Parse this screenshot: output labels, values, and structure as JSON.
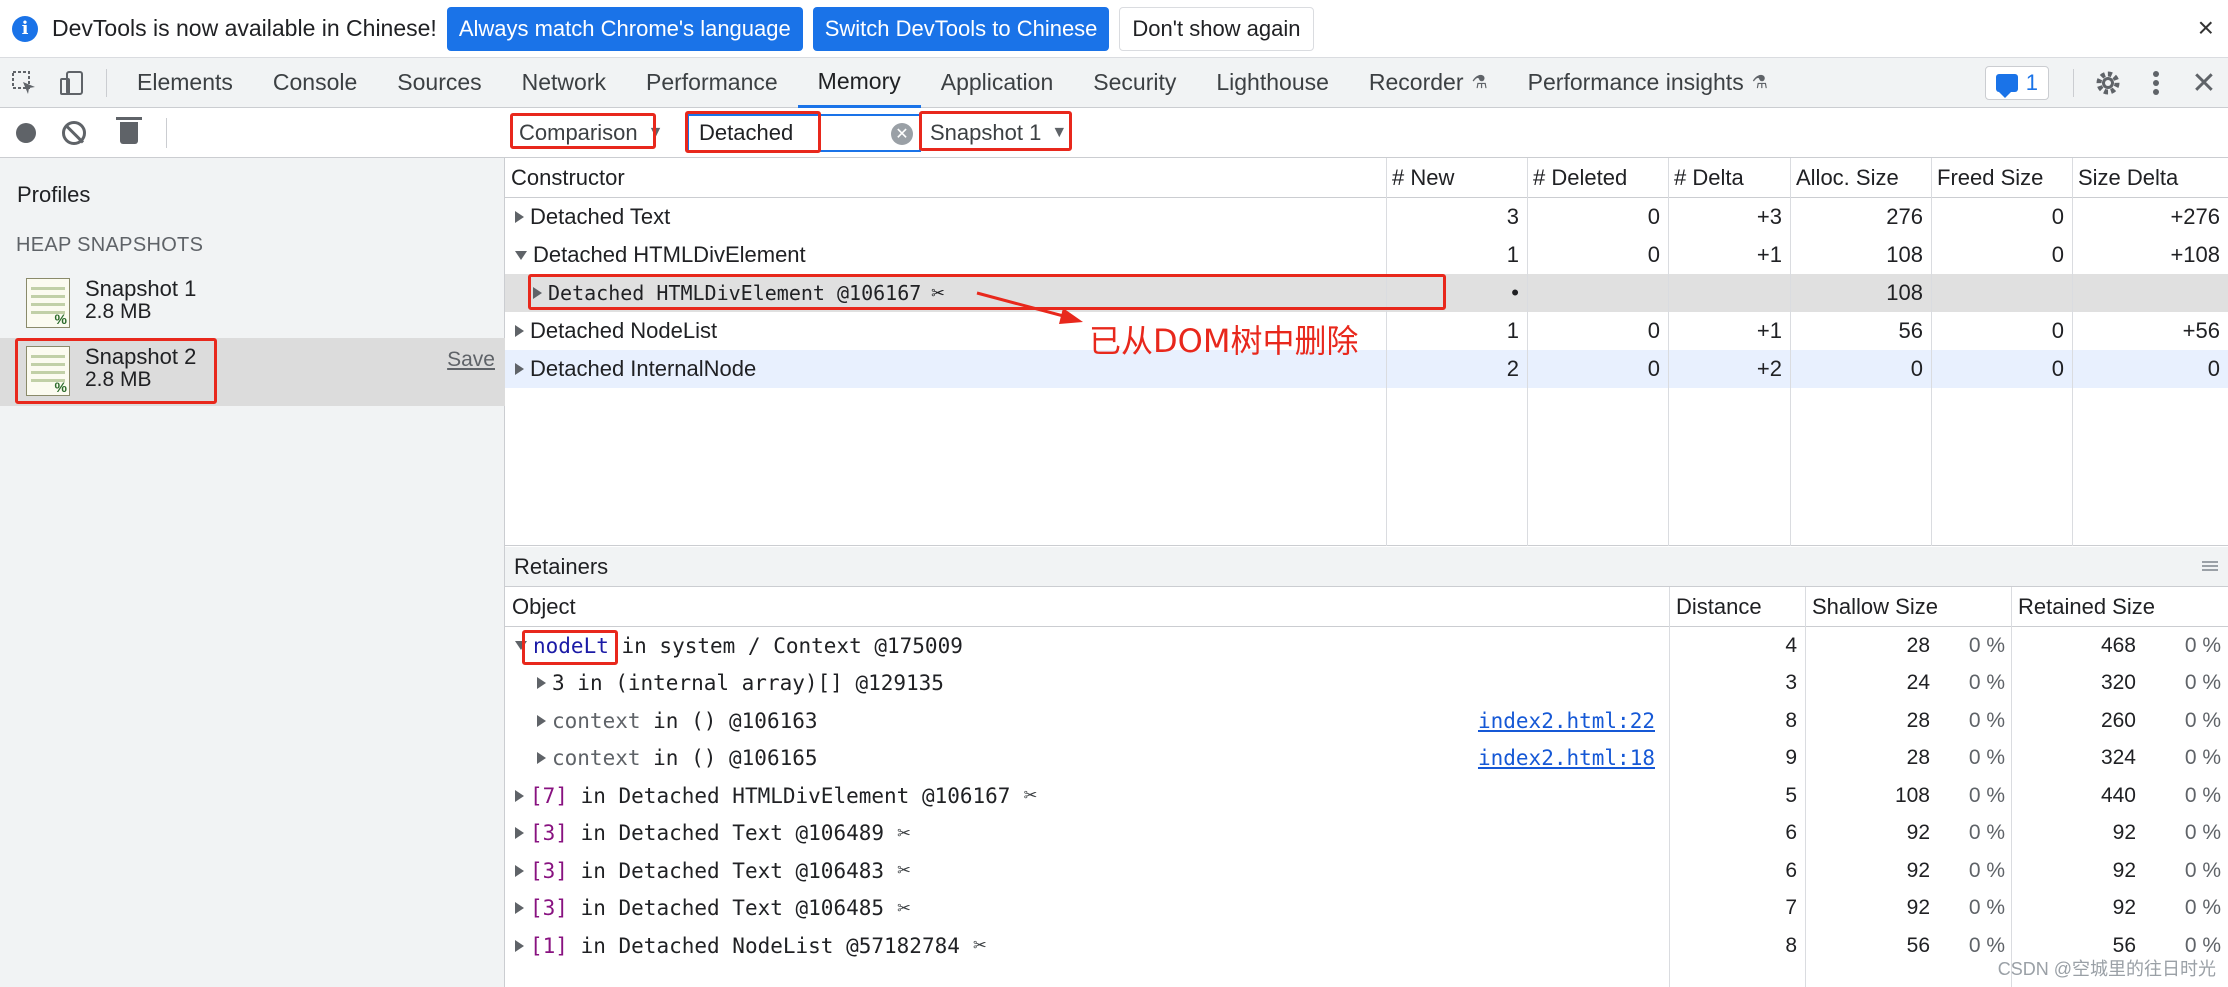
{
  "infobar": {
    "message": "DevTools is now available in Chinese!",
    "btn_match": "Always match Chrome's language",
    "btn_switch": "Switch DevTools to Chinese",
    "btn_dismiss": "Don't show again",
    "close": "×"
  },
  "tabs": [
    {
      "label": "Elements"
    },
    {
      "label": "Console"
    },
    {
      "label": "Sources"
    },
    {
      "label": "Network"
    },
    {
      "label": "Performance"
    },
    {
      "label": "Memory"
    },
    {
      "label": "Application"
    },
    {
      "label": "Security"
    },
    {
      "label": "Lighthouse"
    },
    {
      "label": "Recorder"
    },
    {
      "label": "Performance insights"
    }
  ],
  "tabbar": {
    "active_tab": "Memory",
    "issues_count": "1"
  },
  "toolbar": {
    "view": "Comparison",
    "filter": "Detached",
    "base_snapshot": "Snapshot 1"
  },
  "sidebar": {
    "title": "Profiles",
    "heading": "HEAP SNAPSHOTS",
    "snapshots": [
      {
        "name": "Snapshot 1",
        "size": "2.8 MB"
      },
      {
        "name": "Snapshot 2",
        "size": "2.8 MB",
        "action": "Save"
      }
    ]
  },
  "grid": {
    "headers": [
      "Constructor",
      "# New",
      "# Deleted",
      "# Delta",
      "Alloc. Size",
      "Freed Size",
      "Size Delta"
    ],
    "rows": [
      {
        "name": "Detached Text",
        "new": "3",
        "deleted": "0",
        "delta": "+3",
        "alloc": "276",
        "freed": "0",
        "size_delta": "+276"
      },
      {
        "name": "Detached HTMLDivElement",
        "new": "1",
        "deleted": "0",
        "delta": "+1",
        "alloc": "108",
        "freed": "0",
        "size_delta": "+108"
      },
      {
        "name": "Detached HTMLDivElement @106167",
        "new": "•",
        "deleted": "",
        "delta": "",
        "alloc": "108",
        "freed": "",
        "size_delta": ""
      },
      {
        "name": "Detached NodeList",
        "new": "1",
        "deleted": "0",
        "delta": "+1",
        "alloc": "56",
        "freed": "0",
        "size_delta": "+56"
      },
      {
        "name": "Detached InternalNode",
        "new": "2",
        "deleted": "0",
        "delta": "+2",
        "alloc": "0",
        "freed": "0",
        "size_delta": "0"
      }
    ]
  },
  "annotation": {
    "text": "已从DOM树中删除"
  },
  "retainers": {
    "title": "Retainers",
    "headers": [
      "Object",
      "Distance",
      "Shallow Size",
      "Retained Size"
    ],
    "rows": [
      {
        "key": "nodeLt",
        "rest": " in system / Context @175009",
        "link": "",
        "distance": "4",
        "shallow": "28",
        "shallow_pct": "0 %",
        "retained": "468",
        "retained_pct": "0 %"
      },
      {
        "key": "3",
        "rest": " in (internal array)[] @129135",
        "link": "",
        "distance": "3",
        "shallow": "24",
        "shallow_pct": "0 %",
        "retained": "320",
        "retained_pct": "0 %"
      },
      {
        "key": "context",
        "rest": " in () @106163",
        "link": "index2.html:22",
        "distance": "8",
        "shallow": "28",
        "shallow_pct": "0 %",
        "retained": "260",
        "retained_pct": "0 %"
      },
      {
        "key": "context",
        "rest": " in () @106165",
        "link": "index2.html:18",
        "distance": "9",
        "shallow": "28",
        "shallow_pct": "0 %",
        "retained": "324",
        "retained_pct": "0 %"
      },
      {
        "key": "[7]",
        "rest": " in Detached HTMLDivElement @106167",
        "link": "",
        "distance": "5",
        "shallow": "108",
        "shallow_pct": "0 %",
        "retained": "440",
        "retained_pct": "0 %"
      },
      {
        "key": "[3]",
        "rest": " in Detached Text @106489",
        "link": "",
        "distance": "6",
        "shallow": "92",
        "shallow_pct": "0 %",
        "retained": "92",
        "retained_pct": "0 %"
      },
      {
        "key": "[3]",
        "rest": " in Detached Text @106483",
        "link": "",
        "distance": "6",
        "shallow": "92",
        "shallow_pct": "0 %",
        "retained": "92",
        "retained_pct": "0 %"
      },
      {
        "key": "[3]",
        "rest": " in Detached Text @106485",
        "link": "",
        "distance": "7",
        "shallow": "92",
        "shallow_pct": "0 %",
        "retained": "92",
        "retained_pct": "0 %"
      },
      {
        "key": "[1]",
        "rest": " in Detached NodeList @57182784",
        "link": "",
        "distance": "8",
        "shallow": "56",
        "shallow_pct": "0 %",
        "retained": "56",
        "retained_pct": "0 %"
      }
    ]
  },
  "watermark": "CSDN @空城里的往日时光",
  "colors": {
    "accent": "#1a73e8",
    "highlight": "#e8281c"
  },
  "icons": [
    "info-icon",
    "inspect-icon",
    "device-icon",
    "flask-icon",
    "issues-icon",
    "gear-icon",
    "kebab-icon",
    "close-icon",
    "record-icon",
    "clear-icon",
    "trash-icon",
    "scissors-icon",
    "expand-icon"
  ]
}
